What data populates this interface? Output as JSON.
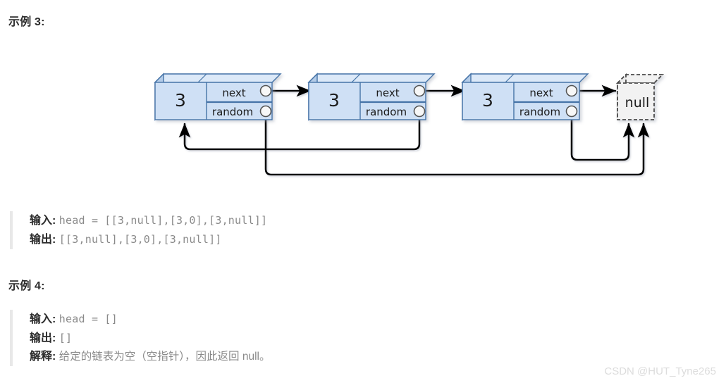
{
  "page": {
    "watermark": "CSDN @HUT_Tyne265"
  },
  "examples": [
    {
      "heading": "示例 3:",
      "lines": [
        {
          "label": "输入:",
          "value": "head = [[3,null],[3,0],[3,null]]",
          "style": "mono"
        },
        {
          "label": "输出:",
          "value": "[[3,null],[3,0],[3,null]]",
          "style": "mono"
        }
      ]
    },
    {
      "heading": "示例 4:",
      "lines": [
        {
          "label": "输入:",
          "value": "head = []",
          "style": "mono"
        },
        {
          "label": "输出:",
          "value": "[]",
          "style": "mono"
        },
        {
          "label": "解释:",
          "value": "给定的链表为空（空指针），因此返回 null。",
          "style": "cn"
        }
      ]
    }
  ],
  "diagram": {
    "type": "linked-list-with-random-pointers",
    "node_value": "3",
    "next_label": "next",
    "random_label": "random",
    "null_label": "null",
    "nodes": [
      {
        "id": "node-1",
        "value": "3",
        "next": "node-2",
        "random": "null"
      },
      {
        "id": "node-2",
        "value": "3",
        "next": "node-3",
        "random": "node-1"
      },
      {
        "id": "node-3",
        "value": "3",
        "next": "null-node",
        "random": "null"
      }
    ],
    "colors": {
      "node_fill": "#c5d9f1",
      "node_face_fill": "#cfe0f5",
      "node_border": "#4573a7",
      "node_top_fill": "#dce9f8",
      "node_side_fill": "#b4cce8",
      "null_fill": "#f2f2f2",
      "null_border": "#4a4a4a",
      "arrow": "#000000",
      "port_fill": "#f7f7f7",
      "port_border": "#555555"
    }
  }
}
